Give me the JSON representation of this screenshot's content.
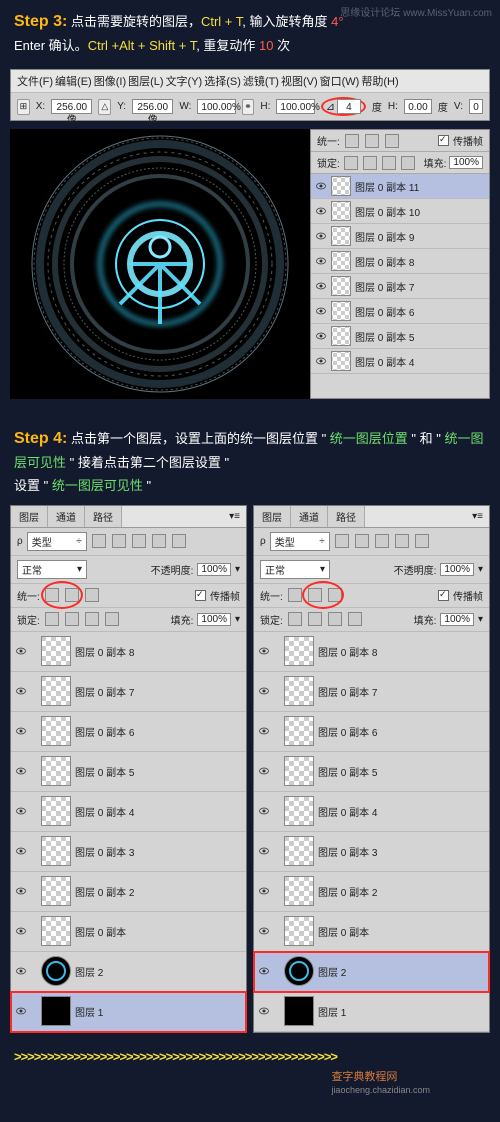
{
  "watermark": "思缘设计论坛 www.MissYuan.com",
  "step3": {
    "label": "Step 3:",
    "line1a": " 点击需要旋转的图层，",
    "key1": "Ctrl + T",
    "line1b": ", 输入旋转角度 ",
    "angle": "4°",
    "line2a": "Enter 确认。",
    "key2": "Ctrl +Alt + Shift + T",
    "line2b": ", 重复动作 ",
    "times": "10",
    "line2c": " 次"
  },
  "menu": {
    "file": "文件(F)",
    "edit": "编辑(E)",
    "image": "图像(I)",
    "layer": "图层(L)",
    "type": "文字(Y)",
    "select": "选择(S)",
    "filter": "滤镜(T)",
    "view": "视图(V)",
    "window": "窗口(W)",
    "help": "帮助(H)"
  },
  "toolbar": {
    "x_label": "X:",
    "x_val": "256.00 像",
    "y_label": "Y:",
    "y_val": "256.00 像",
    "w_label": "W:",
    "w_val": "100.00%",
    "h_label": "H:",
    "h_val": "100.00%",
    "angle_val": "4",
    "angle_unit": "度",
    "h2_label": "H:",
    "h2_val": "0.00",
    "unit2": "度",
    "v_label": "V:",
    "v_val": "0"
  },
  "mini_panel": {
    "unify": "统一:",
    "propagate": "传播帧",
    "lock": "锁定:",
    "fill": "填充:",
    "fill_val": "100%",
    "layers": [
      "图层 0 副本 11",
      "图层 0 副本 10",
      "图层 0 副本 9",
      "图层 0 副本 8",
      "图层 0 副本 7",
      "图层 0 副本 6",
      "图层 0 副本 5",
      "图层 0 副本 4"
    ]
  },
  "step4": {
    "label": "Step 4:",
    "line1": " 点击第一个图层，设置上面的统一图层位置 \" ",
    "g1": "统一图层位置",
    "line2": " \" 和 \" ",
    "g2": "统一图层可见性",
    "line3": " \" 接着点击第二个图层设置 \" ",
    "g3": "统一图层可见性",
    "line4": " \""
  },
  "panel": {
    "tab_layer": "图层",
    "tab_channel": "通道",
    "tab_path": "路径",
    "type_label": "类型",
    "blend": "正常",
    "opacity_label": "不透明度:",
    "opacity_val": "100%",
    "unify": "统一:",
    "propagate": "传播帧",
    "lock": "锁定:",
    "fill": "填充:",
    "fill_val": "100%"
  },
  "left_layers": [
    {
      "name": "图层 0 副本 8",
      "type": "t"
    },
    {
      "name": "图层 0 副本 7",
      "type": "t"
    },
    {
      "name": "图层 0 副本 6",
      "type": "t"
    },
    {
      "name": "图层 0 副本 5",
      "type": "t"
    },
    {
      "name": "图层 0 副本 4",
      "type": "t"
    },
    {
      "name": "图层 0 副本 3",
      "type": "t"
    },
    {
      "name": "图层 0 副本 2",
      "type": "t"
    },
    {
      "name": "图层 0 副本",
      "type": "t"
    },
    {
      "name": "图层 2",
      "type": "ring"
    },
    {
      "name": "图层 1",
      "type": "black",
      "sel": true,
      "red": true
    }
  ],
  "right_layers": [
    {
      "name": "图层 0 副本 8",
      "type": "t"
    },
    {
      "name": "图层 0 副本 7",
      "type": "t"
    },
    {
      "name": "图层 0 副本 6",
      "type": "t"
    },
    {
      "name": "图层 0 副本 5",
      "type": "t"
    },
    {
      "name": "图层 0 副本 4",
      "type": "t"
    },
    {
      "name": "图层 0 副本 3",
      "type": "t"
    },
    {
      "name": "图层 0 副本 2",
      "type": "t"
    },
    {
      "name": "图层 0 副本",
      "type": "t"
    },
    {
      "name": "图层 2",
      "type": "ring",
      "sel": true,
      "red": true
    },
    {
      "name": "图层 1",
      "type": "black"
    }
  ],
  "chevrons": ">>>>>>>>>>>>>>>>>>>>>>>>>>>>>>>>>>>>>>>>>>>>>>>>>",
  "footer": {
    "brand": "查字典教程网",
    "url": "jiaocheng.chazidian.com"
  }
}
